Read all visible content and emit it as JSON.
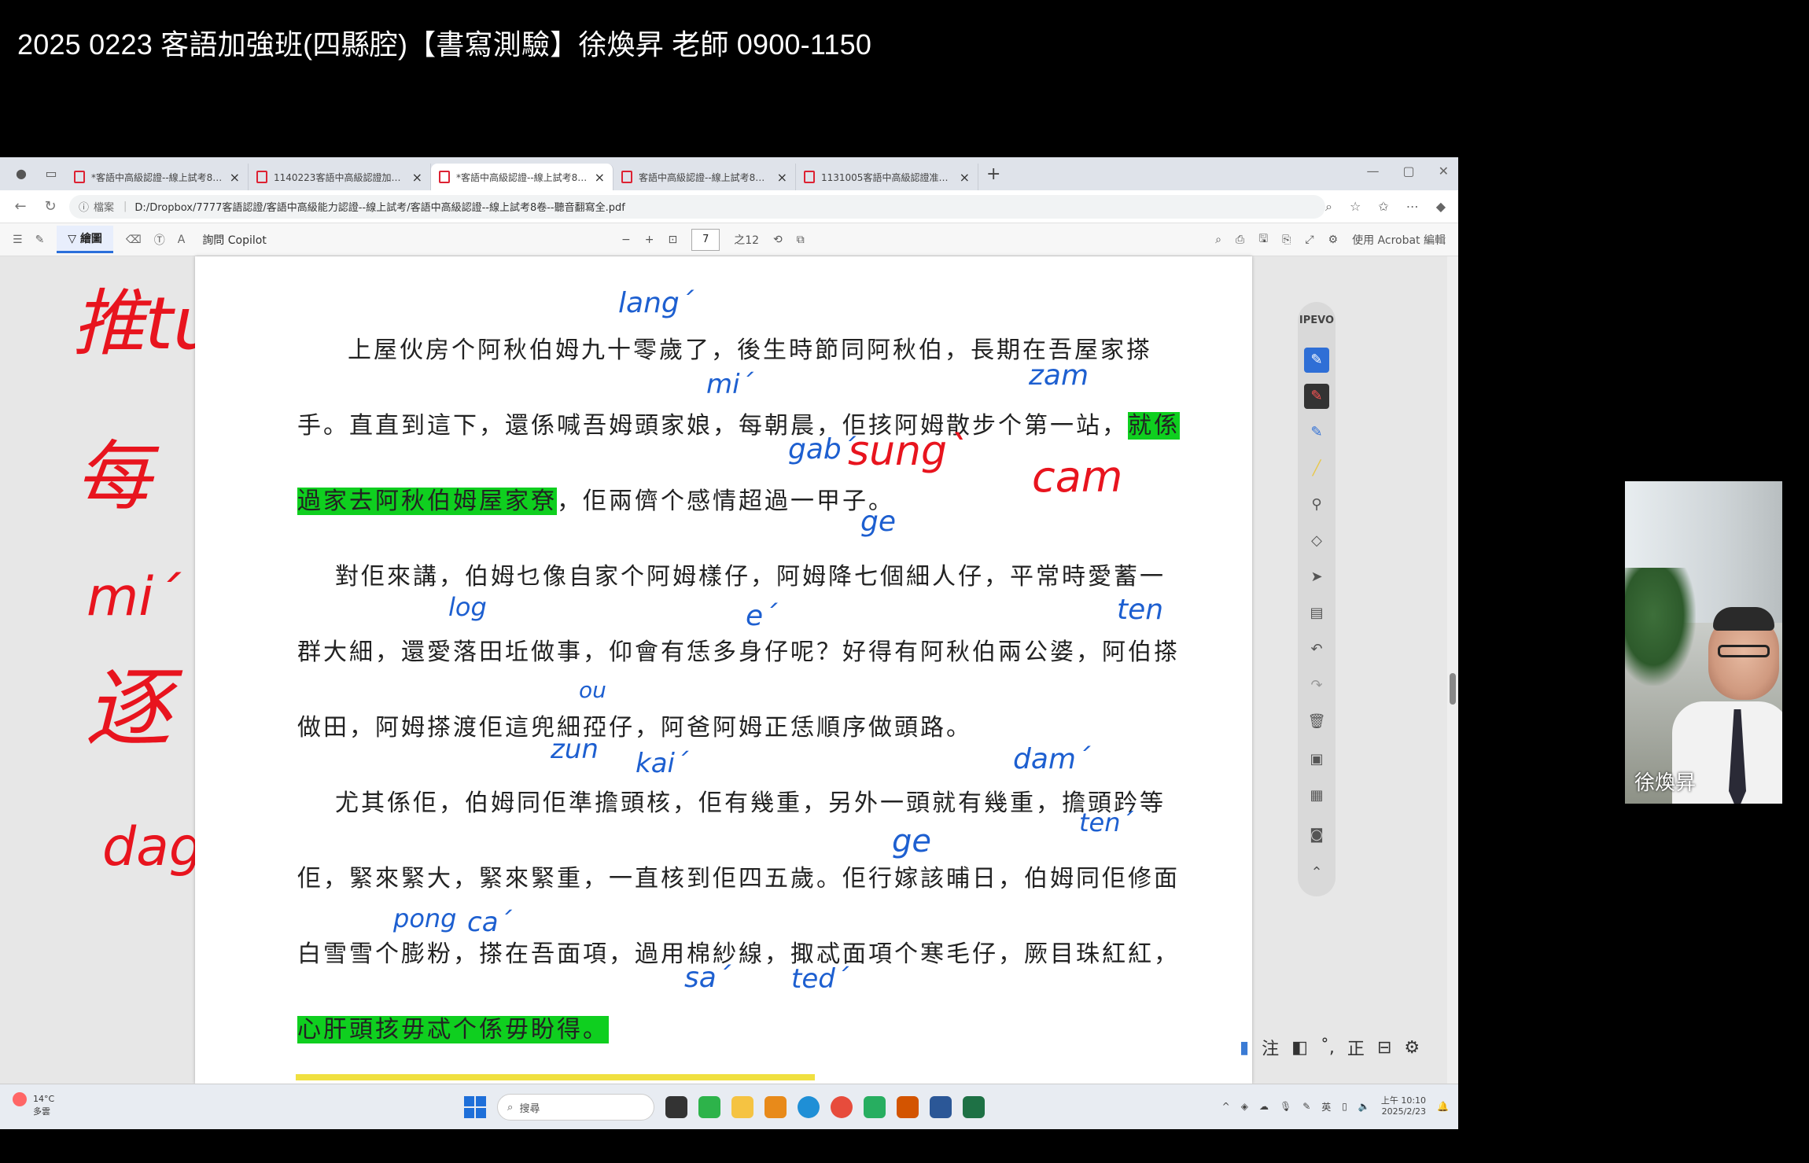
{
  "video": {
    "title": "2025 0223 客語加強班(四縣腔)【書寫測驗】徐煥昇 老師 0900-1150"
  },
  "browser": {
    "tabs": [
      {
        "label": "*客語中高級認證--線上試考8卷--"
      },
      {
        "label": "1140223客語中高級認證加強班--"
      },
      {
        "label": "*客語中高級認證--線上試考8卷--"
      },
      {
        "label": "客語中高級認證--線上試考8卷.pdf"
      },
      {
        "label": "1131005客語中高級認證准考證--"
      }
    ],
    "new_tab": "+",
    "tab_close": "×",
    "url_label": "檔案",
    "url": "D:/Dropbox/7777客語認證/客語中高級能力認證--線上試考/客語中高級認證--線上試考8卷--聽音翻寫全.pdf"
  },
  "pdf_toolbar": {
    "draw_label": "繪圖",
    "copilot_label": "詢問 Copilot",
    "zoom_out": "−",
    "zoom_in": "+",
    "page_current": "7",
    "page_total": "之12",
    "acrobat_label": "使用 Acrobat 編輯"
  },
  "document": {
    "lines": [
      {
        "text": "上屋伙房个阿秋伯姆九十零歲了，後生時節同阿秋伯，長期在吾屋家搽"
      },
      {
        "text": "手。直直到這下，還係喊吾姆頭家娘，每朝晨，佢㧡阿姆散步个第一站，",
        "hl": "就係"
      },
      {
        "hl": "過家去阿秋伯姆屋家尞",
        "text": "，佢兩儕个感情超過一甲子。"
      },
      {
        "text": "對佢來講，伯姆乜像自家个阿姆樣仔，阿姆降七個細人仔，平常時愛蓄一"
      },
      {
        "text": "群大細，還愛落田坵做事，仰會有恁多身仔呢？好得有阿秋伯兩公婆，阿伯搽"
      },
      {
        "text": "做田，阿姆搽渡佢這兜細孲仔，阿爸阿姆正恁順序做頭路。"
      },
      {
        "text": "尤其係佢，伯姆同佢準擔頭核，佢有幾重，另外一頭就有幾重，擔頭趻等"
      },
      {
        "text": "佢，緊來緊大，緊來緊重，一直核到佢四五歲。佢行嫁該晡日，伯姆同佢修面"
      },
      {
        "text": "白雪雪个膨粉，搽在吾面項，過用棉紗線，掫忒面項个寒毛仔，厥目珠紅紅，"
      },
      {
        "hl": "心肝頭㧡毋忒个係毋盼得。"
      }
    ]
  },
  "annotations": {
    "red": [
      "推tui´",
      "每",
      "mi´",
      "逐",
      "dag`",
      "sung`",
      "cam"
    ],
    "blue": [
      "lang´",
      "mi´",
      "zam",
      "gab´",
      "ge",
      "log",
      "e´",
      "ten",
      "ou",
      "zun",
      "kai´",
      "dam´",
      "ten´",
      "ge",
      "pong",
      "ca´",
      "sa´",
      "ted´"
    ]
  },
  "ipevo": {
    "logo": "IPEVO"
  },
  "taskbar": {
    "weather_temp": "14°C",
    "weather_desc": "多雲",
    "search_placeholder": "搜尋",
    "clock_time": "上午 10:10",
    "clock_date": "2025/2/23"
  },
  "minibar": {
    "items": [
      "注",
      "正"
    ]
  },
  "webcam": {
    "name": "徐煥昇"
  },
  "colors": {
    "highlight": "#0fcf1f",
    "red_ink": "#e8141e",
    "blue_ink": "#1d5fd0",
    "accent": "#2f6fd6"
  }
}
